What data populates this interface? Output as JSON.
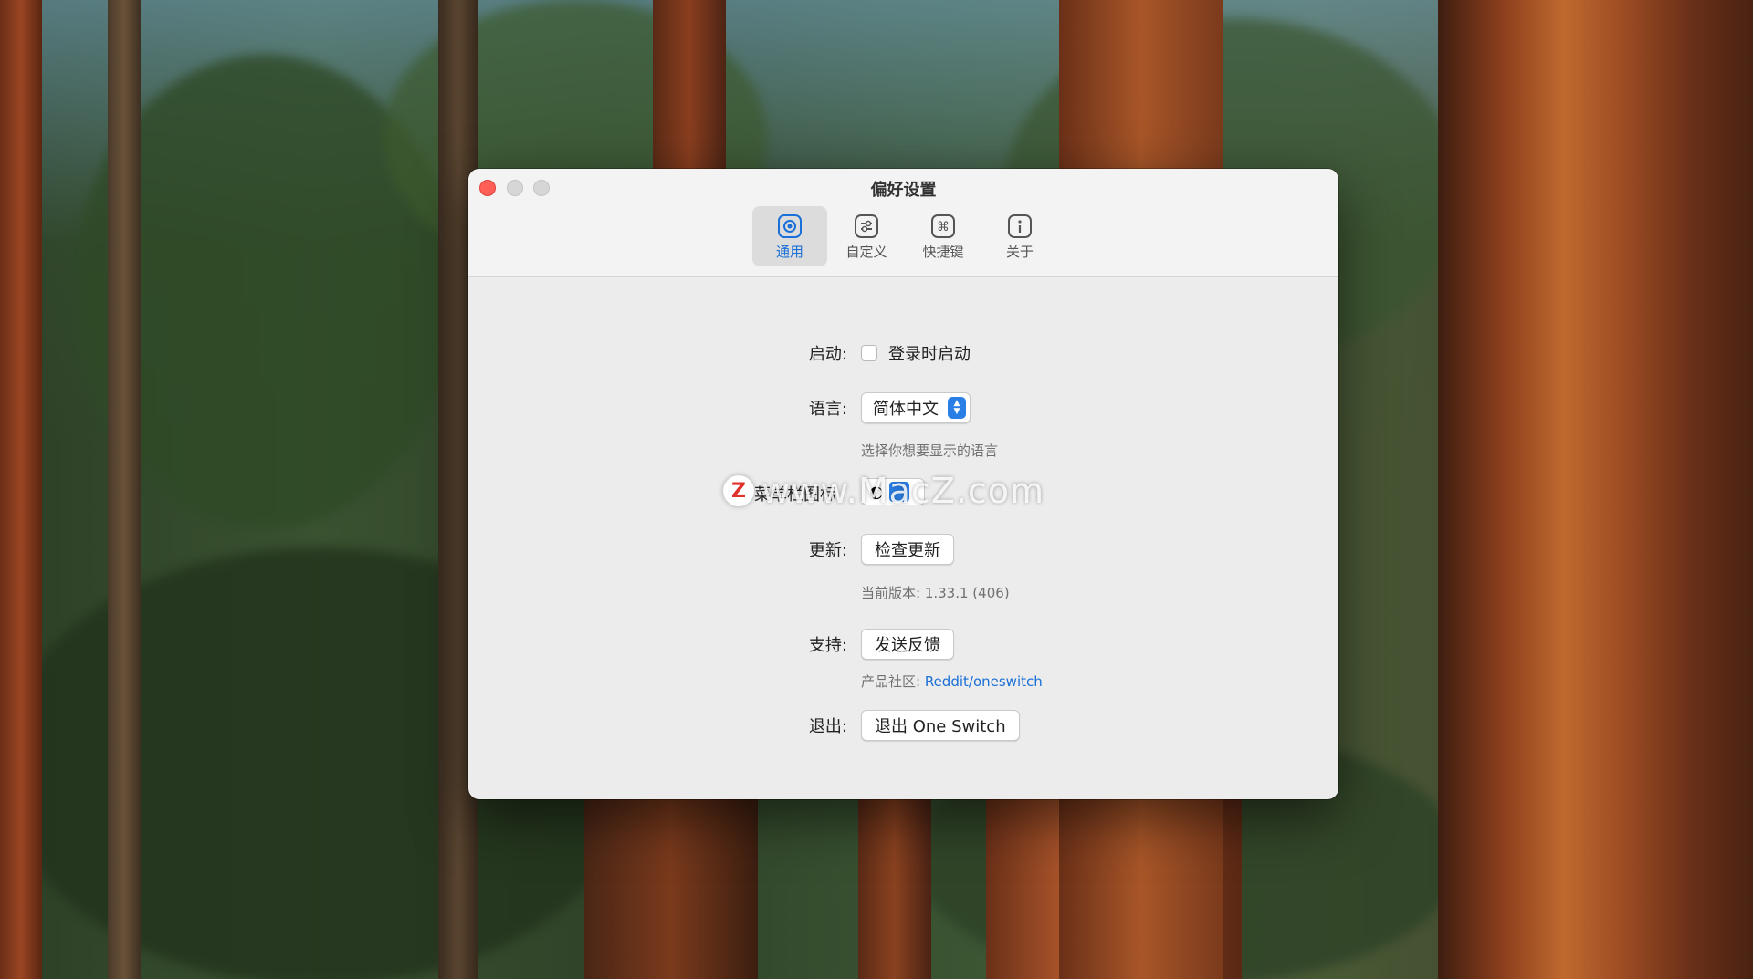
{
  "window": {
    "title": "偏好设置"
  },
  "tabs": [
    {
      "label": "通用",
      "icon": "gear-icon",
      "selected": true
    },
    {
      "label": "自定义",
      "icon": "sliders-icon",
      "selected": false
    },
    {
      "label": "快捷键",
      "icon": "command-icon",
      "selected": false
    },
    {
      "label": "关于",
      "icon": "info-icon",
      "selected": false
    }
  ],
  "general": {
    "launch": {
      "label": "启动:",
      "checkbox_label": "登录时启动",
      "checked": false
    },
    "language": {
      "label": "语言:",
      "value": "简体中文",
      "hint": "选择你想要显示的语言"
    },
    "menu_icon": {
      "label": "菜单栏图标"
    },
    "update": {
      "label": "更新:",
      "button": "检查更新",
      "version": "当前版本: 1.33.1 (406)"
    },
    "support": {
      "label": "支持:",
      "button": "发送反馈",
      "community_prefix": "产品社区: ",
      "community_link": "Reddit/oneswitch"
    },
    "quit": {
      "label": "退出:",
      "button": "退出 One Switch"
    }
  },
  "watermark": {
    "logo": "Z",
    "text": "www.MacZ.com"
  },
  "colors": {
    "accent": "#1a6fd8",
    "close": "#ff5f57",
    "window_bg": "#ececec"
  }
}
